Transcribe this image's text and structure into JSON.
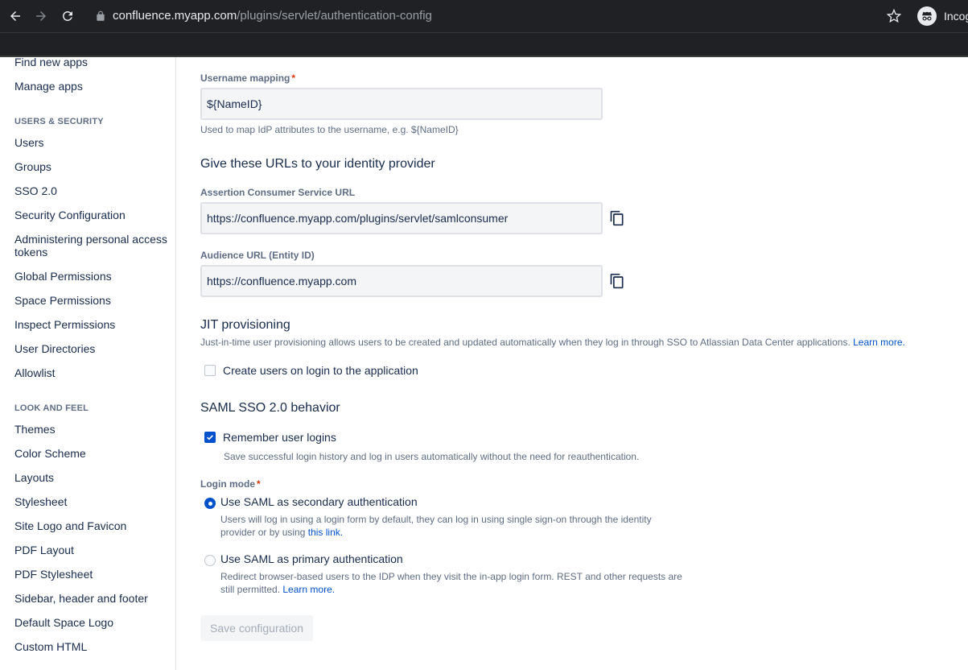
{
  "browser": {
    "url_host": "confluence.myapp.com",
    "url_path": "/plugins/servlet/authentication-config",
    "profile_label": "Incognito"
  },
  "sidebar": {
    "top_items": [
      "Find new apps",
      "Manage apps"
    ],
    "users_security": {
      "heading": "USERS & SECURITY",
      "items": [
        "Users",
        "Groups",
        "SSO 2.0",
        "Security Configuration",
        "Administering personal access tokens",
        "Global Permissions",
        "Space Permissions",
        "Inspect Permissions",
        "User Directories",
        "Allowlist"
      ]
    },
    "look_feel": {
      "heading": "LOOK AND FEEL",
      "items": [
        "Themes",
        "Color Scheme",
        "Layouts",
        "Stylesheet",
        "Site Logo and Favicon",
        "PDF Layout",
        "PDF Stylesheet",
        "Sidebar, header and footer",
        "Default Space Logo",
        "Custom HTML"
      ]
    }
  },
  "form": {
    "username_mapping": {
      "label": "Username mapping",
      "required_mark": "*",
      "value": "${NameID}",
      "help": "Used to map IdP attributes to the username, e.g. ${NameID}"
    },
    "urls_section_title": "Give these URLs to your identity provider",
    "acs_url": {
      "label": "Assertion Consumer Service URL",
      "value": "https://confluence.myapp.com/plugins/servlet/samlconsumer"
    },
    "audience_url": {
      "label": "Audience URL (Entity ID)",
      "value": "https://confluence.myapp.com"
    },
    "jit": {
      "title": "JIT provisioning",
      "description": "Just-in-time user provisioning allows users to be created and updated automatically when they log in through SSO to Atlassian Data Center applications.",
      "learn_more": "Learn more.",
      "checkbox_label": "Create users on login to the application",
      "checked": false
    },
    "behavior": {
      "title": "SAML SSO 2.0 behavior",
      "remember_label": "Remember user logins",
      "remember_checked": true,
      "remember_help": "Save successful login history and log in users automatically without the need for reauthentication."
    },
    "login_mode": {
      "label": "Login mode",
      "required_mark": "*",
      "secondary": {
        "label": "Use SAML as secondary authentication",
        "help_line1": "Users will log in using a login form by default, they can log in using single sign-on through the identity",
        "help_line2": "provider or by using",
        "link": "this link.",
        "selected": true
      },
      "primary": {
        "label": "Use SAML as primary authentication",
        "help_line1": "Redirect browser-based users to the IDP when they visit the in-app login form. REST and other requests are",
        "help_line2": "still permitted.",
        "link": "Learn more.",
        "selected": false
      }
    },
    "save_label": "Save configuration"
  }
}
